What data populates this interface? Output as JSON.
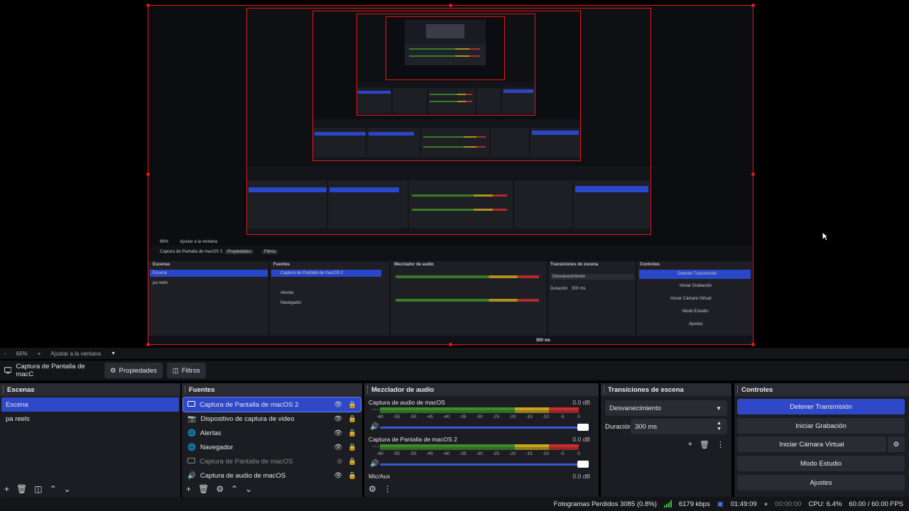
{
  "preview": {
    "nested_title": "Captura de Pantalla de macOS 2",
    "nested_lines": [
      "Escenas",
      "Fuentes",
      "Mezclador de audio",
      "Transiciones de escena",
      "Controles",
      "Detener Transmisión",
      "Iniciar Grabación",
      "Iniciar Cámara Virtual",
      "Modo Estudio",
      "Ajustes",
      "Escena",
      "pa reels",
      "Alertas",
      "Navegador",
      "Desvanecimiento",
      "Duración",
      "300 ms",
      "Fotogramas Perdidos 3085 (0.8%)",
      "6179 kbps",
      "01:49:09",
      "CPU: 6.4%",
      "60.00 / 60.00 FPS",
      "Propiedades",
      "Filtros",
      "66%",
      "Ajustar a la ventana"
    ]
  },
  "zoombar": {
    "minus": "-",
    "zoom": "66%",
    "plus": "+",
    "fit": "Ajustar a la ventana"
  },
  "toolbar": {
    "source_name": "Captura de Pantalla de macC",
    "properties": "Propiedades",
    "filters": "Filtros"
  },
  "scenes": {
    "title": "Escenas",
    "items": [
      "Escena",
      "pa reels"
    ]
  },
  "sources": {
    "title": "Fuentes",
    "items": [
      {
        "label": "Captura de Pantalla de macOS 2",
        "icon": "monitor-icon",
        "selected": true,
        "hidden": false
      },
      {
        "label": "Dispositivo de captura de video",
        "icon": "camera-icon",
        "selected": false,
        "hidden": false
      },
      {
        "label": "Alertas",
        "icon": "globe-icon",
        "selected": false,
        "hidden": false
      },
      {
        "label": "Navegador",
        "icon": "globe-icon",
        "selected": false,
        "hidden": false
      },
      {
        "label": "Captura de Pantalla de macOS",
        "icon": "monitor-icon",
        "selected": false,
        "hidden": true
      },
      {
        "label": "Captura de audio de macOS",
        "icon": "speaker-icon",
        "selected": false,
        "hidden": false
      }
    ]
  },
  "mixer": {
    "title": "Mezclador de audio",
    "scale": [
      "-60",
      "-55",
      "-50",
      "-45",
      "-40",
      "-35",
      "-30",
      "-25",
      "-20",
      "-15",
      "-10",
      "-5",
      "0"
    ],
    "channels": [
      {
        "name": "Captura de audio de macOS",
        "db": "0.0 dB"
      },
      {
        "name": "Captura de Pantalla de macOS 2",
        "db": "0.0 dB"
      },
      {
        "name": "Mic/Aux",
        "db": "0.0 dB"
      }
    ]
  },
  "transitions": {
    "title": "Transiciones de escena",
    "selected": "Desvanecimiento",
    "duration_label": "Duración",
    "duration_value": "300 ms"
  },
  "controls": {
    "title": "Controles",
    "buttons": [
      "Detener Transmisión",
      "Iniciar Grabación",
      "Iniciar Cámara Virtual",
      "Modo Estudio",
      "Ajustes"
    ]
  },
  "status": {
    "dropped": "Fotogramas Perdidos 3085 (0.8%)",
    "bitrate": "6179 kbps",
    "stream_time": "01:49:09",
    "record_time": "00:00:00",
    "cpu": "CPU: 6.4%",
    "fps": "60.00 / 60.00 FPS"
  },
  "colors": {
    "accent": "#2f48c7",
    "selection_border": "#e01a1a",
    "meter_green": "#3d8b2a",
    "meter_yellow": "#c7a51d",
    "meter_red": "#c92c2c"
  }
}
